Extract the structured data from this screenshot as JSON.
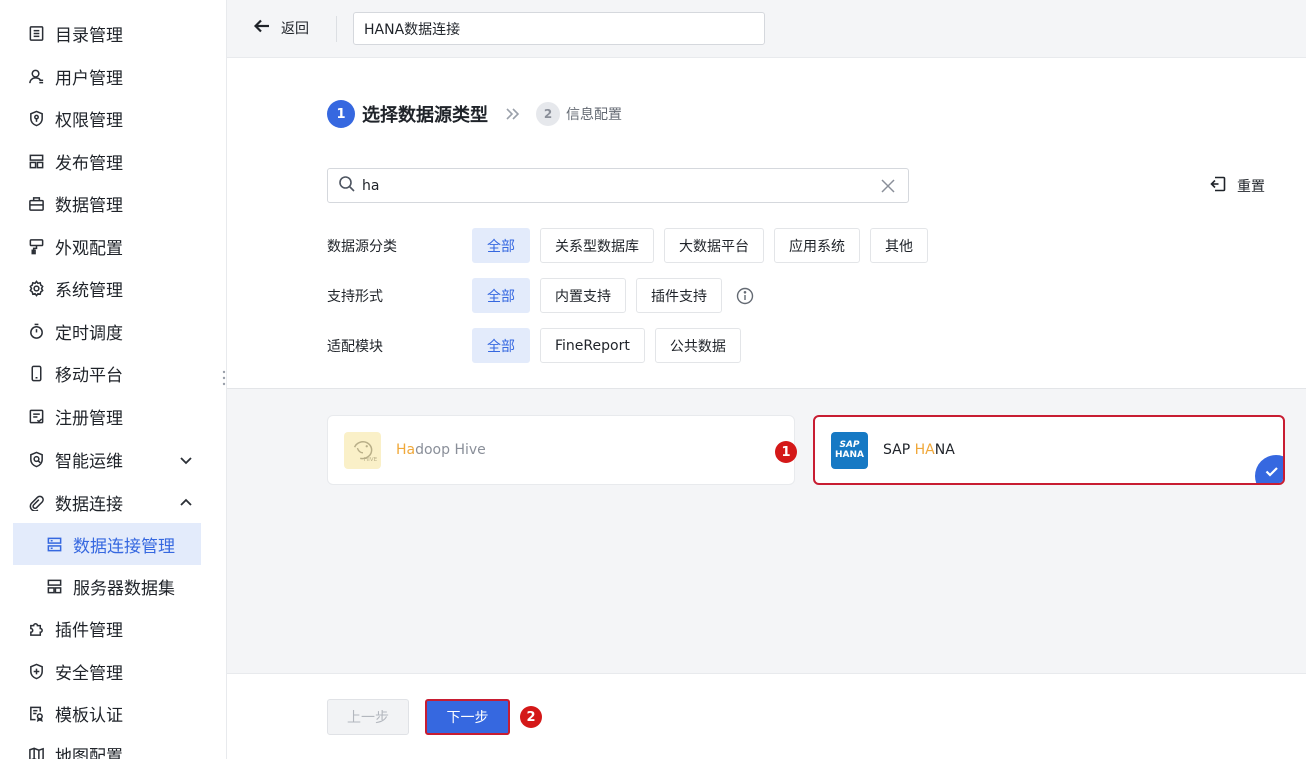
{
  "sidebar": {
    "items": [
      {
        "label": "目录管理",
        "icon": "catalog-icon"
      },
      {
        "label": "用户管理",
        "icon": "user-icon"
      },
      {
        "label": "权限管理",
        "icon": "shield-key-icon"
      },
      {
        "label": "发布管理",
        "icon": "publish-icon"
      },
      {
        "label": "数据管理",
        "icon": "data-icon"
      },
      {
        "label": "外观配置",
        "icon": "paint-icon"
      },
      {
        "label": "系统管理",
        "icon": "gear-icon"
      },
      {
        "label": "定时调度",
        "icon": "timer-icon"
      },
      {
        "label": "移动平台",
        "icon": "mobile-icon"
      },
      {
        "label": "注册管理",
        "icon": "register-icon"
      },
      {
        "label": "智能运维",
        "icon": "ops-icon"
      },
      {
        "label": "数据连接",
        "icon": "link-icon"
      },
      {
        "label": "数据连接管理",
        "icon": "server-icon"
      },
      {
        "label": "服务器数据集",
        "icon": "dataset-icon"
      },
      {
        "label": "插件管理",
        "icon": "plugin-icon"
      },
      {
        "label": "安全管理",
        "icon": "security-icon"
      },
      {
        "label": "模板认证",
        "icon": "template-icon"
      },
      {
        "label": "地图配置",
        "icon": "map-icon"
      }
    ]
  },
  "header": {
    "back_label": "返回",
    "connection_name": "HANA数据连接"
  },
  "steps": {
    "step1_num": "1",
    "step1_label": "选择数据源类型",
    "step2_num": "2",
    "step2_label": "信息配置"
  },
  "search": {
    "value": "ha"
  },
  "reset_label": "重置",
  "filters": {
    "category": {
      "label": "数据源分类",
      "options": [
        "全部",
        "关系型数据库",
        "大数据平台",
        "应用系统",
        "其他"
      ],
      "selected": "全部"
    },
    "support": {
      "label": "支持形式",
      "options": [
        "全部",
        "内置支持",
        "插件支持"
      ],
      "selected": "全部"
    },
    "module": {
      "label": "适配模块",
      "options": [
        "全部",
        "FineReport",
        "公共数据"
      ],
      "selected": "全部"
    }
  },
  "results": {
    "hive": {
      "pre": "",
      "hl": "Ha",
      "post": "doop Hive",
      "icon": "hive-logo-icon"
    },
    "hana": {
      "pre": "SAP ",
      "hl": "HA",
      "post": "NA",
      "icon": "sap-hana-logo-icon",
      "logo_line1": "SAP",
      "logo_line2": "HANA"
    }
  },
  "markers": {
    "m1": "1",
    "m2": "2"
  },
  "footer": {
    "prev_label": "上一步",
    "next_label": "下一步"
  },
  "colors": {
    "accent": "#3668e0",
    "highlight": "#f0a83a",
    "marker": "#d41818"
  }
}
